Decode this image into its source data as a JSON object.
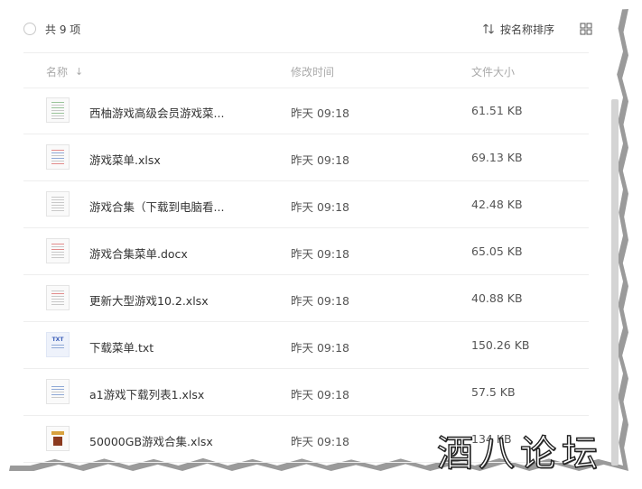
{
  "toolbar": {
    "count_label": "共 9 项",
    "sort_label": "按名称排序",
    "sort_icon": "sort-arrows-icon",
    "view_icon": "grid-view-icon"
  },
  "table": {
    "headers": {
      "name": "名称",
      "modified": "修改时间",
      "size": "文件大小"
    },
    "sort_indicator": "↓",
    "rows": [
      {
        "name": "西柚游戏高级会员游戏菜...",
        "modified": "昨天 09:18",
        "size": "61.51 KB",
        "thumb": "sheet"
      },
      {
        "name": "游戏菜单.xlsx",
        "modified": "昨天 09:18",
        "size": "69.13 KB",
        "thumb": "sheet"
      },
      {
        "name": "游戏合集（下载到电脑看...",
        "modified": "昨天 09:18",
        "size": "42.48 KB",
        "thumb": "doc"
      },
      {
        "name": "游戏合集菜单.docx",
        "modified": "昨天 09:18",
        "size": "65.05 KB",
        "thumb": "doc"
      },
      {
        "name": "更新大型游戏10.2.xlsx",
        "modified": "昨天 09:18",
        "size": "40.88 KB",
        "thumb": "sheet"
      },
      {
        "name": "下载菜单.txt",
        "modified": "昨天 09:18",
        "size": "150.26 KB",
        "thumb": "txt"
      },
      {
        "name": "a1游戏下载列表1.xlsx",
        "modified": "昨天 09:18",
        "size": "57.5 KB",
        "thumb": "sheet"
      },
      {
        "name": "50000GB游戏合集.xlsx",
        "modified": "昨天 09:18",
        "size": "134 KB",
        "thumb": "dark"
      }
    ]
  },
  "watermark": "酒八论坛",
  "txt_thumb_tag": "TXT",
  "colors": {
    "divider": "#eeeeee",
    "header_text": "#aaaaaa",
    "scrollbar": "#d4d4d4"
  }
}
